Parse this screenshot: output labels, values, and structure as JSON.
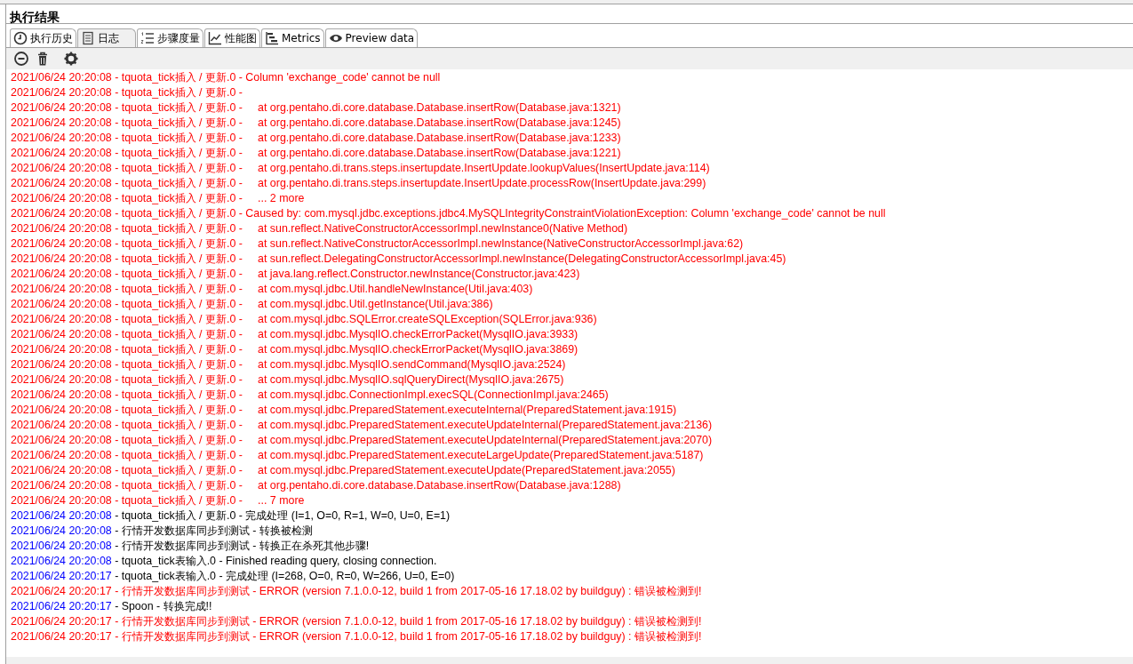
{
  "panel": {
    "title": "执行结果"
  },
  "tabs": [
    {
      "label": "执行历史",
      "selected": false
    },
    {
      "label": "日志",
      "selected": true
    },
    {
      "label": "步骤度量",
      "selected": false
    },
    {
      "label": "性能图",
      "selected": false
    },
    {
      "label": "Metrics",
      "selected": false
    },
    {
      "label": "Preview data",
      "selected": false
    }
  ],
  "log": [
    {
      "kind": "error",
      "time": "2021/06/24 20:20:08",
      "text": " - tquota_tick插入 / 更新.0 - Column 'exchange_code' cannot be null"
    },
    {
      "kind": "error",
      "time": "2021/06/24 20:20:08",
      "text": " - tquota_tick插入 / 更新.0 - "
    },
    {
      "kind": "error",
      "time": "2021/06/24 20:20:08",
      "text": " - tquota_tick插入 / 更新.0 -     at org.pentaho.di.core.database.Database.insertRow(Database.java:1321)"
    },
    {
      "kind": "error",
      "time": "2021/06/24 20:20:08",
      "text": " - tquota_tick插入 / 更新.0 -     at org.pentaho.di.core.database.Database.insertRow(Database.java:1245)"
    },
    {
      "kind": "error",
      "time": "2021/06/24 20:20:08",
      "text": " - tquota_tick插入 / 更新.0 -     at org.pentaho.di.core.database.Database.insertRow(Database.java:1233)"
    },
    {
      "kind": "error",
      "time": "2021/06/24 20:20:08",
      "text": " - tquota_tick插入 / 更新.0 -     at org.pentaho.di.core.database.Database.insertRow(Database.java:1221)"
    },
    {
      "kind": "error",
      "time": "2021/06/24 20:20:08",
      "text": " - tquota_tick插入 / 更新.0 -     at org.pentaho.di.trans.steps.insertupdate.InsertUpdate.lookupValues(InsertUpdate.java:114)"
    },
    {
      "kind": "error",
      "time": "2021/06/24 20:20:08",
      "text": " - tquota_tick插入 / 更新.0 -     at org.pentaho.di.trans.steps.insertupdate.InsertUpdate.processRow(InsertUpdate.java:299)"
    },
    {
      "kind": "error",
      "time": "2021/06/24 20:20:08",
      "text": " - tquota_tick插入 / 更新.0 -     ... 2 more"
    },
    {
      "kind": "error",
      "time": "2021/06/24 20:20:08",
      "text": " - tquota_tick插入 / 更新.0 - Caused by: com.mysql.jdbc.exceptions.jdbc4.MySQLIntegrityConstraintViolationException: Column 'exchange_code' cannot be null"
    },
    {
      "kind": "error",
      "time": "2021/06/24 20:20:08",
      "text": " - tquota_tick插入 / 更新.0 -     at sun.reflect.NativeConstructorAccessorImpl.newInstance0(Native Method)"
    },
    {
      "kind": "error",
      "time": "2021/06/24 20:20:08",
      "text": " - tquota_tick插入 / 更新.0 -     at sun.reflect.NativeConstructorAccessorImpl.newInstance(NativeConstructorAccessorImpl.java:62)"
    },
    {
      "kind": "error",
      "time": "2021/06/24 20:20:08",
      "text": " - tquota_tick插入 / 更新.0 -     at sun.reflect.DelegatingConstructorAccessorImpl.newInstance(DelegatingConstructorAccessorImpl.java:45)"
    },
    {
      "kind": "error",
      "time": "2021/06/24 20:20:08",
      "text": " - tquota_tick插入 / 更新.0 -     at java.lang.reflect.Constructor.newInstance(Constructor.java:423)"
    },
    {
      "kind": "error",
      "time": "2021/06/24 20:20:08",
      "text": " - tquota_tick插入 / 更新.0 -     at com.mysql.jdbc.Util.handleNewInstance(Util.java:403)"
    },
    {
      "kind": "error",
      "time": "2021/06/24 20:20:08",
      "text": " - tquota_tick插入 / 更新.0 -     at com.mysql.jdbc.Util.getInstance(Util.java:386)"
    },
    {
      "kind": "error",
      "time": "2021/06/24 20:20:08",
      "text": " - tquota_tick插入 / 更新.0 -     at com.mysql.jdbc.SQLError.createSQLException(SQLError.java:936)"
    },
    {
      "kind": "error",
      "time": "2021/06/24 20:20:08",
      "text": " - tquota_tick插入 / 更新.0 -     at com.mysql.jdbc.MysqlIO.checkErrorPacket(MysqlIO.java:3933)"
    },
    {
      "kind": "error",
      "time": "2021/06/24 20:20:08",
      "text": " - tquota_tick插入 / 更新.0 -     at com.mysql.jdbc.MysqlIO.checkErrorPacket(MysqlIO.java:3869)"
    },
    {
      "kind": "error",
      "time": "2021/06/24 20:20:08",
      "text": " - tquota_tick插入 / 更新.0 -     at com.mysql.jdbc.MysqlIO.sendCommand(MysqlIO.java:2524)"
    },
    {
      "kind": "error",
      "time": "2021/06/24 20:20:08",
      "text": " - tquota_tick插入 / 更新.0 -     at com.mysql.jdbc.MysqlIO.sqlQueryDirect(MysqlIO.java:2675)"
    },
    {
      "kind": "error",
      "time": "2021/06/24 20:20:08",
      "text": " - tquota_tick插入 / 更新.0 -     at com.mysql.jdbc.ConnectionImpl.execSQL(ConnectionImpl.java:2465)"
    },
    {
      "kind": "error",
      "time": "2021/06/24 20:20:08",
      "text": " - tquota_tick插入 / 更新.0 -     at com.mysql.jdbc.PreparedStatement.executeInternal(PreparedStatement.java:1915)"
    },
    {
      "kind": "error",
      "time": "2021/06/24 20:20:08",
      "text": " - tquota_tick插入 / 更新.0 -     at com.mysql.jdbc.PreparedStatement.executeUpdateInternal(PreparedStatement.java:2136)"
    },
    {
      "kind": "error",
      "time": "2021/06/24 20:20:08",
      "text": " - tquota_tick插入 / 更新.0 -     at com.mysql.jdbc.PreparedStatement.executeUpdateInternal(PreparedStatement.java:2070)"
    },
    {
      "kind": "error",
      "time": "2021/06/24 20:20:08",
      "text": " - tquota_tick插入 / 更新.0 -     at com.mysql.jdbc.PreparedStatement.executeLargeUpdate(PreparedStatement.java:5187)"
    },
    {
      "kind": "error",
      "time": "2021/06/24 20:20:08",
      "text": " - tquota_tick插入 / 更新.0 -     at com.mysql.jdbc.PreparedStatement.executeUpdate(PreparedStatement.java:2055)"
    },
    {
      "kind": "error",
      "time": "2021/06/24 20:20:08",
      "text": " - tquota_tick插入 / 更新.0 -     at org.pentaho.di.core.database.Database.insertRow(Database.java:1288)"
    },
    {
      "kind": "error",
      "time": "2021/06/24 20:20:08",
      "text": " - tquota_tick插入 / 更新.0 -     ... 7 more"
    },
    {
      "kind": "info",
      "time": "2021/06/24 20:20:08",
      "text": " - tquota_tick插入 / 更新.0 - 完成处理 (I=1, O=0, R=1, W=0, U=0, E=1)"
    },
    {
      "kind": "info",
      "time": "2021/06/24 20:20:08",
      "text": " - 行情开发数据库同步到测试 - 转换被检测"
    },
    {
      "kind": "info",
      "time": "2021/06/24 20:20:08",
      "text": " - 行情开发数据库同步到测试 - 转换正在杀死其他步骤!"
    },
    {
      "kind": "info",
      "time": "2021/06/24 20:20:08",
      "text": " - tquota_tick表输入.0 - Finished reading query, closing connection."
    },
    {
      "kind": "info",
      "time": "2021/06/24 20:20:17",
      "text": " - tquota_tick表输入.0 - 完成处理 (I=268, O=0, R=0, W=266, U=0, E=0)"
    },
    {
      "kind": "error",
      "time": "2021/06/24 20:20:17",
      "text": " - 行情开发数据库同步到测试 - ERROR (version 7.1.0.0-12, build 1 from 2017-05-16 17.18.02 by buildguy) : 错误被检测到!"
    },
    {
      "kind": "info",
      "time": "2021/06/24 20:20:17",
      "text": " - Spoon - 转换完成!!"
    },
    {
      "kind": "error",
      "time": "2021/06/24 20:20:17",
      "text": " - 行情开发数据库同步到测试 - ERROR (version 7.1.0.0-12, build 1 from 2017-05-16 17.18.02 by buildguy) : 错误被检测到!"
    },
    {
      "kind": "error",
      "time": "2021/06/24 20:20:17",
      "text": " - 行情开发数据库同步到测试 - ERROR (version 7.1.0.0-12, build 1 from 2017-05-16 17.18.02 by buildguy) : 错误被检测到!"
    }
  ]
}
